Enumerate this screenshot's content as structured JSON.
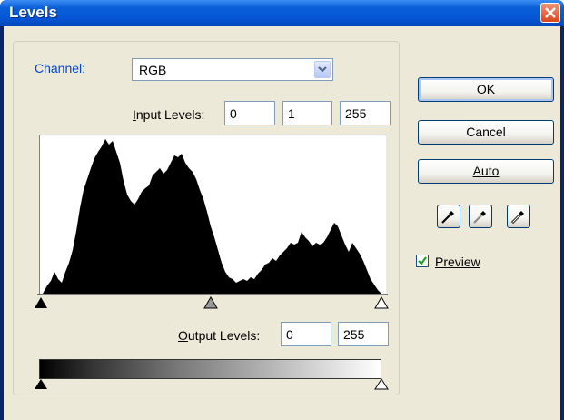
{
  "window": {
    "title": "Levels"
  },
  "channel": {
    "label": "Channel:",
    "value": "RGB"
  },
  "input_levels": {
    "label": "Input Levels:",
    "black": "0",
    "gamma": "1",
    "white": "255"
  },
  "output_levels": {
    "label": "Output Levels:",
    "black": "0",
    "white": "255"
  },
  "buttons": {
    "ok": "OK",
    "cancel": "Cancel",
    "auto": "Auto"
  },
  "preview": {
    "label": "Preview",
    "checked": true
  },
  "colors": {
    "title_bar": "#0a5fd8",
    "client_bg": "#ece9d8",
    "channel_label": "#0046d5",
    "close_button": "#d8451e"
  },
  "icons": [
    "close-icon",
    "dropdown-arrow-icon",
    "black-eyedropper-icon",
    "gray-eyedropper-icon",
    "white-eyedropper-icon",
    "check-icon"
  ]
}
